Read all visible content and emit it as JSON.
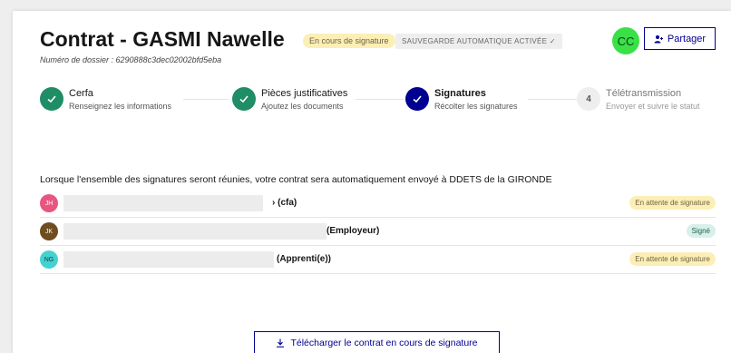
{
  "header": {
    "title": "Contrat - GASMI Nawelle",
    "status_badge": "En cours de signature",
    "autosave_badge": "SAUVEGARDE AUTOMATIQUE ACTIVÉE ✓",
    "dossier": "Numéro de dossier : 6290888c3dec02002bfd5eba",
    "user_initials": "CC",
    "share_label": "Partager"
  },
  "steps": [
    {
      "title": "Cerfa",
      "subtitle": "Renseignez les informations",
      "state": "done"
    },
    {
      "title": "Pièces justificatives",
      "subtitle": "Ajoutez les documents",
      "state": "done"
    },
    {
      "title": "Signatures",
      "subtitle": "Récolter les signatures",
      "state": "current"
    },
    {
      "number": "4",
      "title": "Télétransmission",
      "subtitle": "Envoyer et suivre le statut",
      "state": "todo"
    }
  ],
  "info_text": "Lorsque l'ensemble des signatures seront réunies, votre contrat sera automatiquement envoyé à DDETS de la GIRONDE",
  "signatories": [
    {
      "initials": "JH",
      "role": "› (cfa)",
      "status": "En attente de signature",
      "avatar_color": "#e8567f",
      "avatar_text_color": "#ffffff"
    },
    {
      "initials": "JK",
      "role": "(Employeur)",
      "status": "Signé",
      "avatar_color": "#6e4d1f",
      "avatar_text_color": "#ffffff"
    },
    {
      "initials": "NG",
      "role": "(Apprenti(e))",
      "status": "En attente de signature",
      "avatar_color": "#46d1d1",
      "avatar_text_color": "#0a3a3a"
    }
  ],
  "download_label": "Télécharger le contrat en cours de signature",
  "colors": {
    "primary": "#000091",
    "success": "#1f8d65",
    "pending_bg": "#fcefb6",
    "signed_bg": "#d8f0ea"
  }
}
